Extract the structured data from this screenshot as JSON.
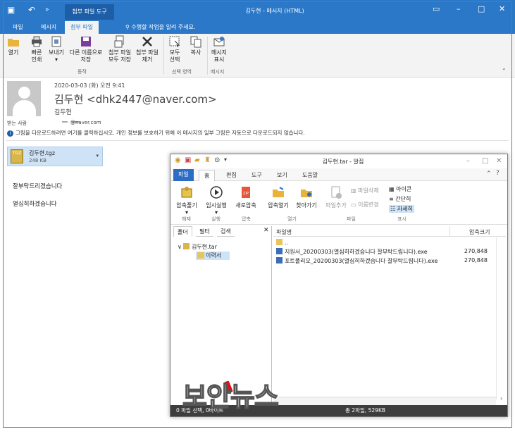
{
  "outlook": {
    "title": "김두현 - 메시지 (HTML)",
    "context_tab": "첨부 파일 도구",
    "tabs": [
      "파일",
      "메시지",
      "첨부 파일"
    ],
    "tell_me": "수행할 작업을 알려 주세요.",
    "ribbon": {
      "open": "열기",
      "quick_print": [
        "빠른",
        "인쇄"
      ],
      "preview": [
        "보내기",
        "▾"
      ],
      "save_as": [
        "다른 이름으로",
        "저장"
      ],
      "save_all": [
        "첨부 파일",
        "모두 저장"
      ],
      "remove": [
        "첨부 파일",
        "제거"
      ],
      "select_all": [
        "모두",
        "선택"
      ],
      "copy": "복사",
      "show_message": [
        "메시지",
        "표시"
      ],
      "group_actions": "동작",
      "group_selection": "선택 영역",
      "group_message": "메시지"
    },
    "message": {
      "date": "2020-03-03 (화) 오전 9:41",
      "from": "김두현 <dhk2447@naver.com>",
      "from_name": "김두현",
      "to_label": "받는 사람",
      "to_value": "       @naver.com",
      "warning": "그림을 다운로드하려면 여기를 클릭하십시오. 개인 정보를 보호하기 위해 이 메시지의 일부 그림은 자동으로 다운로드되지 않습니다.",
      "attachment_name": "김두현.tgz",
      "attachment_size": "248 KB",
      "body_lines": [
        "잘부탁드리겠습니다",
        "열심히하겠습니다"
      ]
    }
  },
  "bandizip": {
    "title": "김두현.tar - 알집",
    "tabs": [
      "파일",
      "홈",
      "편집",
      "도구",
      "보기",
      "도움말"
    ],
    "ribbon": {
      "extract": [
        "압축풀기",
        "▾"
      ],
      "temp_run": [
        "임시실행",
        "▾"
      ],
      "new_archive": "새로압축",
      "open_archive": "압축열기",
      "find": "찾아가기",
      "add_file": "파일추가",
      "delete_file": "파일삭제",
      "rename": "이름변경",
      "view_icon": "아이콘",
      "view_simple": "간단히",
      "view_detail": "자세히",
      "groups": [
        "해제",
        "실행",
        "압축",
        "열기",
        "파일",
        "표시"
      ]
    },
    "left_tabs": [
      "폴더",
      "필터",
      "검색"
    ],
    "tree_root": "김두현.tar",
    "tree_child": "이력서",
    "columns": {
      "name": "파일명",
      "size": "압축크기"
    },
    "files": [
      {
        "name": "..",
        "size": ""
      },
      {
        "name": "지원서_20200303(열심히하겠습니다 잘부탁드립니다).exe",
        "size": "270,848"
      },
      {
        "name": "포트폴리오_20200303(열심히하겠습니다 잘부탁드립니다).exe",
        "size": "270,848"
      }
    ],
    "status_left": "0 파일 선택, 0바이트",
    "status_right": "총 2파일, 529KB"
  },
  "watermark": "보안뉴스"
}
